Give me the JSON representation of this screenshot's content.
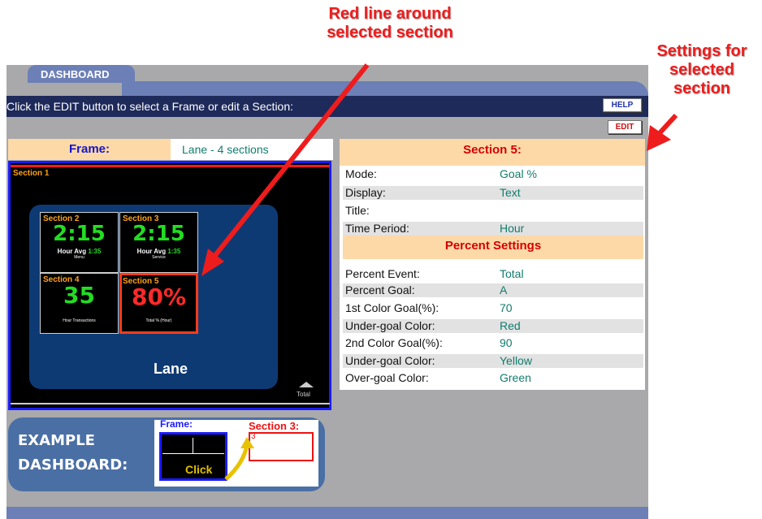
{
  "annotations": {
    "red_line_note": "Red line around\nselected section",
    "settings_note": "Settings for\nselected\nsection"
  },
  "colors": {
    "accent_red": "#ee1c1c",
    "header_navy": "#1e2a5a",
    "band_blue": "#6c7fb6",
    "value_teal": "#117c6e",
    "panel_peach": "#fdd9a8"
  },
  "app": {
    "tab_label": "DASHBOARD",
    "instruction": "Click the EDIT button to select a Frame or edit a Section:",
    "help_label": "HELP",
    "edit_label": "EDIT"
  },
  "frame": {
    "label": "Frame:",
    "value": "Lane - 4 sections"
  },
  "preview": {
    "section1_label": "Section 1",
    "cells": [
      {
        "label": "Section 2",
        "big": "2:15",
        "caption": "Hour Avg",
        "caption_value": "1:35",
        "sub": "Menu"
      },
      {
        "label": "Section 3",
        "big": "2:15",
        "caption": "Hour Avg",
        "caption_value": "1:35",
        "sub": "Service"
      },
      {
        "label": "Section 4",
        "big": "35",
        "sub": "Hour Transactions"
      },
      {
        "label": "Section 5",
        "big": "80%",
        "sub": "Total % (Hour)"
      }
    ],
    "lane_label": "Lane",
    "total_label": "Total"
  },
  "example": {
    "text": "EXAMPLE\nDASHBOARD:",
    "frame_label": "Frame:",
    "section_label": "Section 3:",
    "section_number": "3",
    "click_label": "Click"
  },
  "settings": {
    "title": "Section 5:",
    "rows": [
      {
        "label": "Mode:",
        "value": "Goal %"
      },
      {
        "label": "Display:",
        "value": "Text"
      },
      {
        "label": "Title:",
        "value": ""
      },
      {
        "label": "Time Period:",
        "value": "Hour"
      }
    ],
    "percent_heading": "Percent Settings",
    "percent_rows": [
      {
        "label": "Percent Event:",
        "value": "Total"
      },
      {
        "label": "Percent Goal:",
        "value": "A"
      },
      {
        "label": "1st Color Goal(%):",
        "value": "70"
      },
      {
        "label": "Under-goal Color:",
        "value": "Red"
      },
      {
        "label": "2nd Color Goal(%):",
        "value": "90"
      },
      {
        "label": "Under-goal Color:",
        "value": "Yellow"
      },
      {
        "label": "Over-goal Color:",
        "value": "Green"
      }
    ]
  }
}
